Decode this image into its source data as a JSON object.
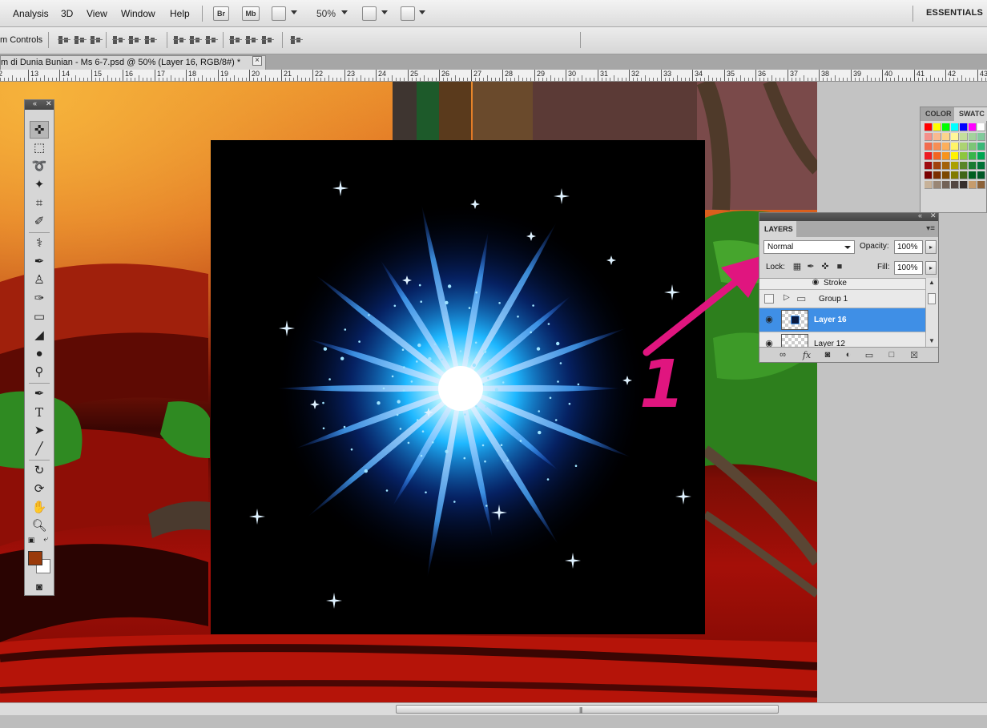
{
  "menu": {
    "items": [
      "Analysis",
      "3D",
      "View",
      "Window",
      "Help"
    ],
    "br_label": "Br",
    "mb_label": "Mb",
    "zoom": "50%",
    "workspace": "ESSENTIALS"
  },
  "options": {
    "label": "m Controls"
  },
  "document": {
    "tab_title": "m di Dunia Bunian - Ms 6-7.psd @ 50% (Layer 16, RGB/8#) *",
    "close": "×"
  },
  "ruler": {
    "labels": [
      "2",
      "13",
      "14",
      "15",
      "16",
      "17",
      "18",
      "19",
      "20",
      "21",
      "22",
      "23",
      "24",
      "25",
      "26",
      "27",
      "28",
      "29",
      "30",
      "31",
      "32",
      "33",
      "34",
      "35",
      "36",
      "37",
      "38",
      "39",
      "40",
      "41",
      "42",
      "43"
    ]
  },
  "swatches_panel": {
    "tabs": [
      "COLOR",
      "SWATC"
    ],
    "colors": [
      "#ff0000",
      "#ffff00",
      "#00ff00",
      "#00ffff",
      "#0000ff",
      "#ff00ff",
      "#ffffff",
      "#f4908b",
      "#f9b98f",
      "#fbd48c",
      "#fff799",
      "#c4df9b",
      "#a3d39c",
      "#82ca9c",
      "#f26c4f",
      "#f68e55",
      "#fbaf5c",
      "#fff467",
      "#acd372",
      "#7cc576",
      "#3bb878",
      "#ed1c24",
      "#f26522",
      "#f7941d",
      "#fff200",
      "#8dc63f",
      "#39b54a",
      "#00a651",
      "#9e0b0f",
      "#a0410d",
      "#a36209",
      "#aba000",
      "#598527",
      "#197b30",
      "#007236",
      "#790000",
      "#7b2e00",
      "#7d4900",
      "#827b00",
      "#406618",
      "#005e20",
      "#005826",
      "#c7b299",
      "#998675",
      "#736357",
      "#534741",
      "#37302d",
      "#c69c6d",
      "#8c6239"
    ]
  },
  "layers_panel": {
    "tab": "LAYERS",
    "blend_mode": "Normal",
    "opacity_label": "Opacity:",
    "opacity": "100%",
    "lock_label": "Lock:",
    "fill_label": "Fill:",
    "fill": "100%",
    "rows": [
      {
        "name": "Stroke"
      },
      {
        "name": "Group 1"
      },
      {
        "name": "Layer 16"
      },
      {
        "name": "Layer 12"
      }
    ]
  },
  "annotation": {
    "number": "1",
    "color": "#e0157f"
  }
}
